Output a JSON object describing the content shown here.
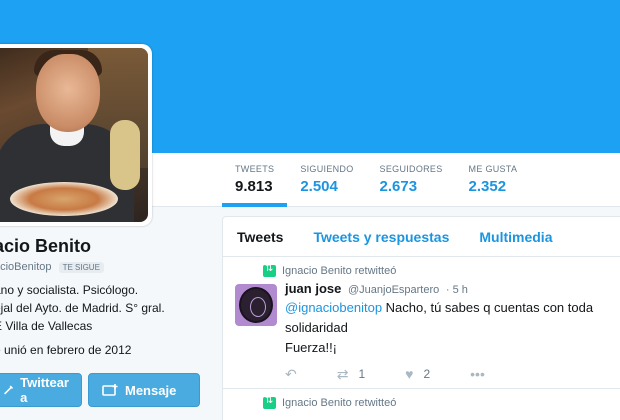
{
  "profile": {
    "name": "acio Benito",
    "handle": "acioBenitop",
    "follows_badge": "TE SIGUE",
    "bio_lines": [
      "ano y socialista. Psicólogo.",
      "ejal del Ayto. de Madrid. S° gral.",
      "E Villa de Vallecas"
    ],
    "joined": "e unió en febrero de 2012",
    "tweet_button": "Twittear a",
    "message_button": "Mensaje"
  },
  "stats": [
    {
      "label": "TWEETS",
      "value": "9.813"
    },
    {
      "label": "SIGUIENDO",
      "value": "2.504"
    },
    {
      "label": "SEGUIDORES",
      "value": "2.673"
    },
    {
      "label": "ME GUSTA",
      "value": "2.352"
    }
  ],
  "timeline_tabs": [
    "Tweets",
    "Tweets y respuestas",
    "Multimedia"
  ],
  "tweets": [
    {
      "retweet_label": "Ignacio Benito retwitteó",
      "name": "juan jose",
      "handle": "@JuanjoEspartero",
      "time": "· 5 h",
      "mention": "@ignaciobenitop",
      "text_line1": " Nacho, tú  sabes q cuentas con toda",
      "text_line2": "solidaridad",
      "text_line3": "Fuerza!!¡",
      "retweets": "1",
      "likes": "2"
    },
    {
      "retweet_label": "Ignacio Benito retwitteó"
    }
  ],
  "colors": {
    "banner": "#1da1f2",
    "link": "#1b95e0",
    "button": "#4aabe0",
    "retweet_green": "#19cf86"
  }
}
